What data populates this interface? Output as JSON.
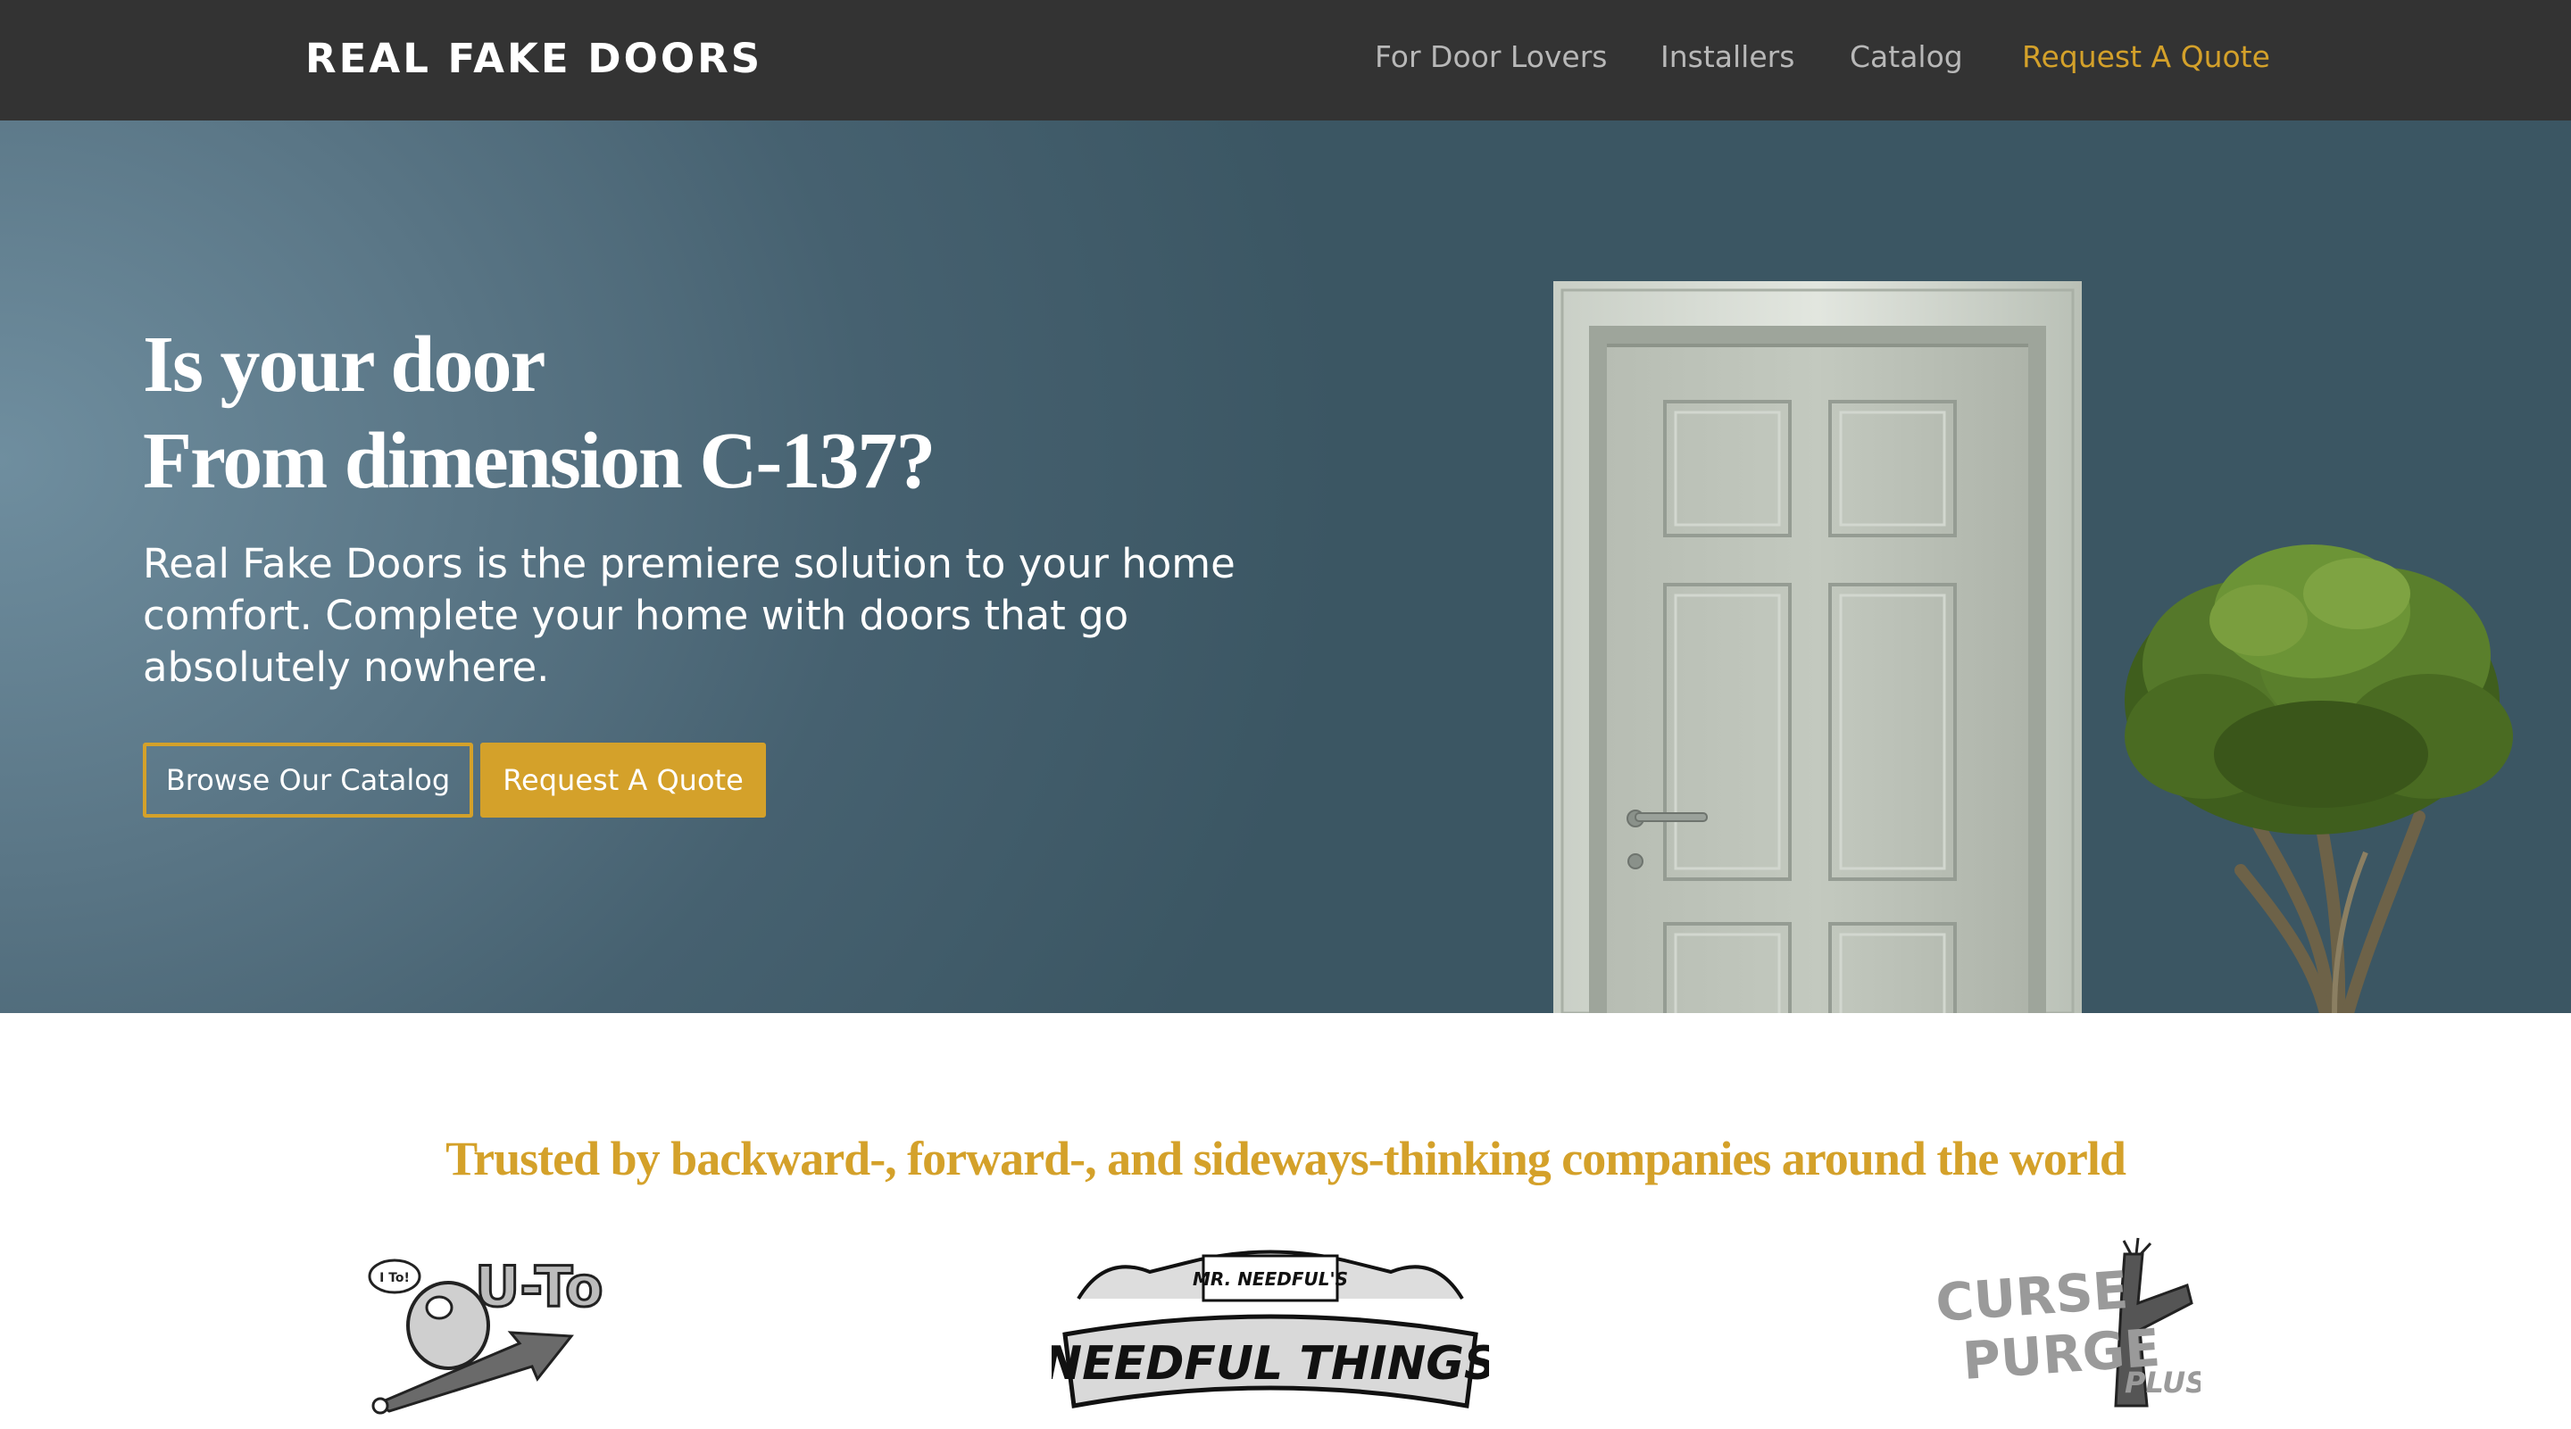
{
  "navbar": {
    "brand": "REAL FAKE DOORS",
    "links": [
      {
        "label": "For Door Lovers"
      },
      {
        "label": "Installers"
      },
      {
        "label": "Catalog"
      },
      {
        "label": "Request A Quote"
      }
    ]
  },
  "hero": {
    "title_line1": "Is your door",
    "title_line2": "From dimension C-137?",
    "text": "Real Fake Doors is the premiere solution to your home comfort. Complete your home with doors that go absolutely nowhere.",
    "btn_catalog": "Browse Our Catalog",
    "btn_quote": "Request A Quote"
  },
  "trusted": {
    "title": "Trusted by backward-, forward-, and sideways-thinking companies around the world",
    "logos": [
      {
        "text": "U-To",
        "bubble": "I To!"
      },
      {
        "top": "MR. NEEDFUL'S",
        "main": "NEEDFUL THINGS"
      },
      {
        "line1": "CURSE",
        "line2": "PURGE",
        "line3": "PLUS!"
      }
    ]
  },
  "colors": {
    "nav_bg": "#333333",
    "accent": "#d4a12a",
    "hero_bg": "#466170",
    "white": "#ffffff"
  }
}
